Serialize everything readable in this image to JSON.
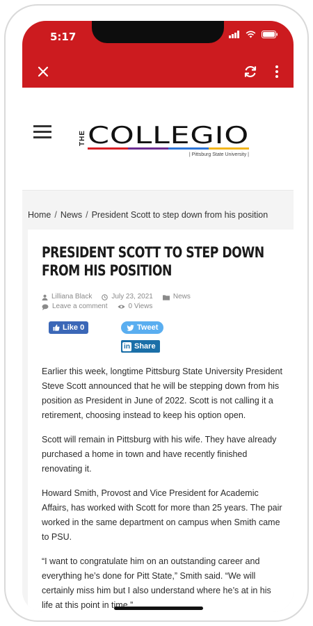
{
  "status_bar": {
    "time": "5:17"
  },
  "toolbar": {
    "close_icon": "close-icon",
    "refresh_icon": "refresh-icon",
    "menu_icon": "more-vertical-icon"
  },
  "site": {
    "logo_the": "THE",
    "logo_name": "COLLEGIO",
    "logo_tagline": "| Pittsburg State University |",
    "logo_colors": [
      "#d81f26",
      "#6b2c91",
      "#2e75d6",
      "#f2b51d"
    ]
  },
  "breadcrumb": {
    "home": "Home",
    "news": "News",
    "current": "President Scott to step down from his position",
    "separator": "/"
  },
  "article": {
    "title": "PRESIDENT SCOTT TO STEP DOWN FROM HIS POSITION",
    "author": "Lilliana Black",
    "date": "July 23, 2021",
    "category": "News",
    "comments": "Leave a comment",
    "views": "0 Views",
    "share": {
      "like": "Like 0",
      "tweet": "Tweet",
      "share": "Share"
    },
    "paragraphs": [
      "Earlier this week, longtime Pittsburg State University President Steve Scott announced that he will be stepping down from his position as President in June of 2022. Scott is not calling it a retirement, choosing instead to keep his option open.",
      "Scott will remain in Pittsburg with his wife. They have already purchased a home in town and have recently finished renovating it.",
      "Howard Smith, Provost and Vice President for Academic Affairs, has worked with Scott for more than 25 years. The pair worked in the same department on campus when Smith came to PSU.",
      "“I want to congratulate him on an outstanding career and everything he’s done for Pitt State,” Smith said. “We will certainly miss him but I also understand where he’s at in his life at this point in time.”"
    ]
  }
}
